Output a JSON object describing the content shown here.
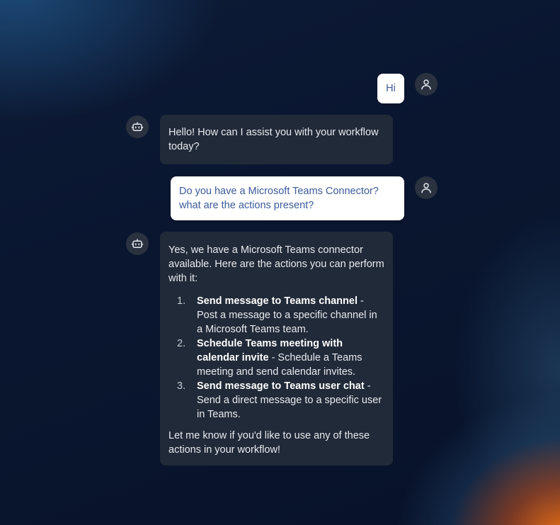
{
  "chat": {
    "messages": [
      {
        "role": "user",
        "text": "Hi"
      },
      {
        "role": "bot",
        "text": "Hello! How can I assist you with your workflow today?"
      },
      {
        "role": "user",
        "text": "Do you have a Microsoft Teams Connector? what are the actions present?"
      },
      {
        "role": "bot",
        "intro": "Yes, we have a Microsoft Teams connector available. Here are the actions you can perform with it:",
        "actions": [
          {
            "num": "1.",
            "title": "Send message to Teams channel",
            "desc": " - Post a message to a specific channel in a Microsoft Teams team."
          },
          {
            "num": "2.",
            "title": "Schedule Teams meeting with calendar invite",
            "desc": " - Schedule a Teams meeting and send calendar invites."
          },
          {
            "num": "3.",
            "title": "Send message to Teams user chat",
            "desc": " - Send a direct message to a specific user in Teams."
          }
        ],
        "outro": "Let me know if you'd like to use any of these actions in your workflow!"
      }
    ]
  },
  "icons": {
    "user": "user-icon",
    "bot": "bot-icon"
  },
  "colors": {
    "user_bubble": "#ffffff",
    "user_text": "#3b5a9a",
    "bot_bubble": "#212a38",
    "bot_text": "#e8ebf0",
    "accent_orange": "#ff7a14"
  }
}
